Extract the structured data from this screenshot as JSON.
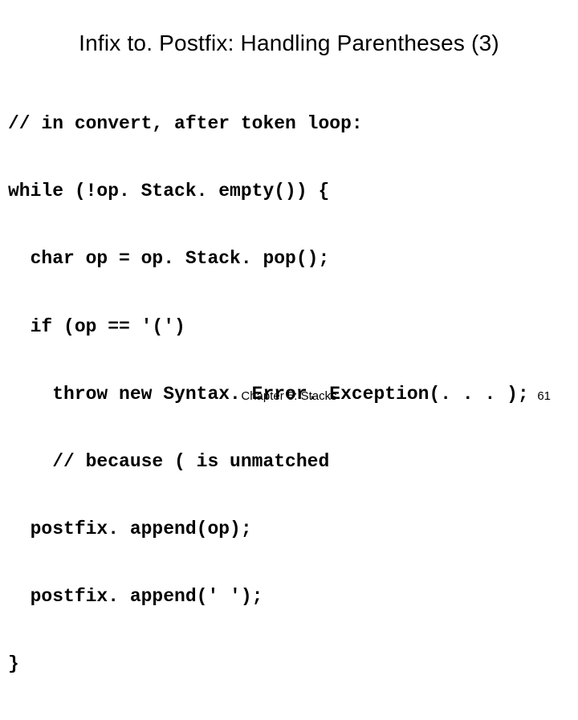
{
  "slide": {
    "title": "Infix to. Postfix: Handling Parentheses (3)",
    "code_lines": [
      "// in convert, after token loop:",
      "while (!op. Stack. empty()) {",
      "  char op = op. Stack. pop();",
      "  if (op == '(')",
      "    throw new Syntax. Error. Exception(. . . );",
      "    // because ( is unmatched",
      "  postfix. append(op);",
      "  postfix. append(' ');",
      "}"
    ],
    "footer_center": "Chapter 5: Stacks",
    "footer_right": "61"
  }
}
